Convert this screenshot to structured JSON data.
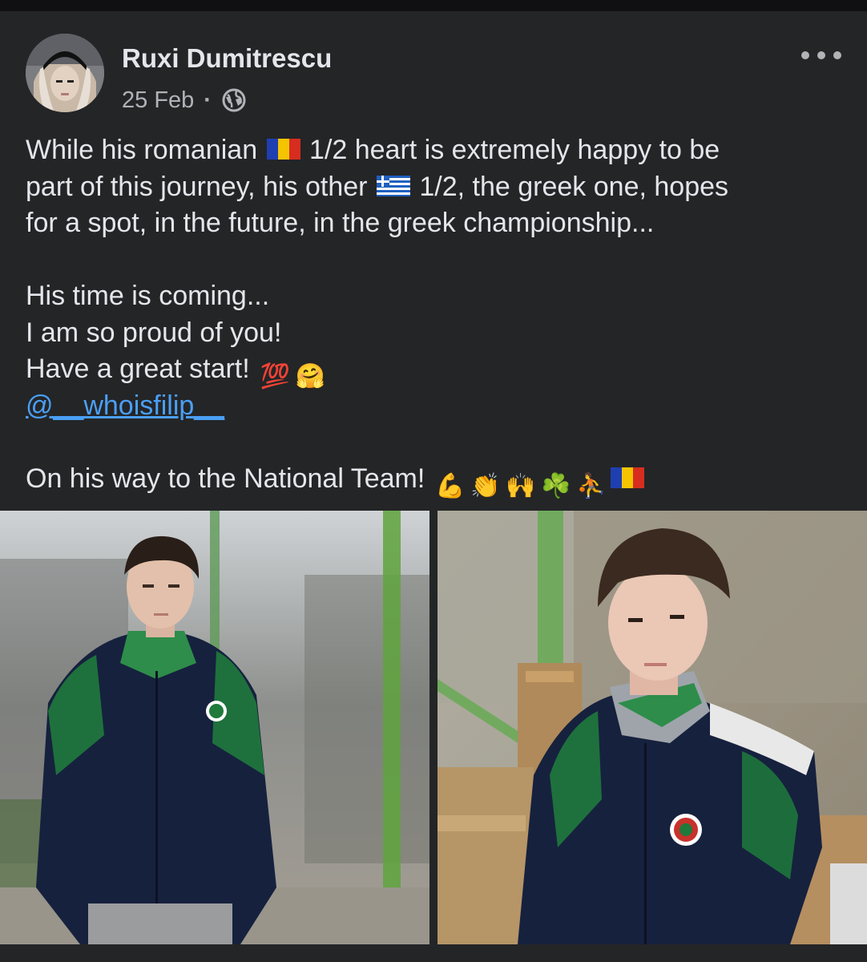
{
  "post": {
    "author_name": "Ruxi Dumitrescu",
    "date": "25 Feb",
    "separator": "·",
    "privacy_icon": "globe-icon",
    "more_icon": "more-options-icon",
    "lines": [
      "While his romanian",
      "1/2 heart is extremely happy to be",
      "part of this journey, his other",
      "1/2, the greek one, hopes",
      "for a spot, in the future, in the greek championship...",
      "His time is coming...",
      "I am so proud of you!",
      "Have a great start!",
      "@__whoisfilip__",
      "On his way to the National Team!"
    ],
    "emojis": {
      "romanian_flag": "romanian-flag",
      "greek_flag": "greek-flag",
      "hundred": "💯",
      "hug": "🤗",
      "muscle": "💪",
      "clap": "👏",
      "raised_hands": "🙌",
      "shamrock": "☘️",
      "basketball": "⛹️"
    },
    "colors": {
      "background": "#242527",
      "text": "#e4e6eb",
      "secondary": "#b0b3b8",
      "mention": "#4a9ff5",
      "jacket_green": "#1f7a3c"
    }
  }
}
